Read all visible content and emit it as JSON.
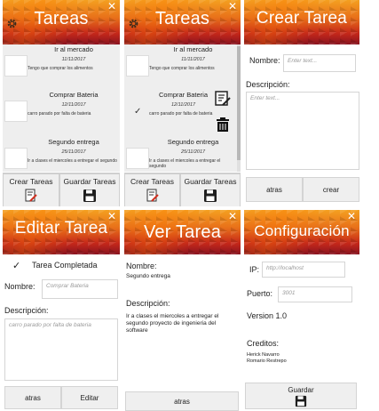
{
  "tareas_screen": {
    "title": "Tareas",
    "close": "✕",
    "tasks": [
      {
        "name": "Ir al mercado",
        "date": "11/11/2017",
        "desc": "Tengo que comprar los alimentos",
        "checked": false
      },
      {
        "name": "Comprar Bateria",
        "date": "12/11/2017",
        "desc": "carro parado por falta de bateria",
        "checked": false
      },
      {
        "name": "Segundo entrega",
        "date": "25/11/2017",
        "desc": "Ir a clases el miercoles a entregar el segundo",
        "checked": false
      }
    ],
    "create_label": "Crear Tareas",
    "save_label": "Guardar Tareas"
  },
  "tareas_screen_selected": {
    "title": "Tareas",
    "close": "✕",
    "check_mark": "✓",
    "tasks": [
      {
        "name": "Ir al mercado",
        "date": "11/11/2017",
        "desc": "Tengo que comprar los alimentos",
        "checked": false
      },
      {
        "name": "Comprar Bateria",
        "date": "12/11/2017",
        "desc": "carro parado por falta de bateria",
        "checked": true
      },
      {
        "name": "Segundo entrega",
        "date": "25/11/2017",
        "desc": "Ir a clases el miercoles a entregar el segundo",
        "checked": false
      }
    ],
    "create_label": "Crear Tareas",
    "save_label": "Guardar Tareas"
  },
  "crear_screen": {
    "title": "Crear Tarea",
    "nombre_label": "Nombre:",
    "nombre_placeholder": "Enter text...",
    "descripcion_label": "Descripción:",
    "descripcion_placeholder": "Enter text...",
    "back_label": "atras",
    "create_label": "crear"
  },
  "editar_screen": {
    "title": "Editar Tarea",
    "close": "✕",
    "check_mark": "✓",
    "completed_label": "Tarea Completada",
    "nombre_label": "Nombre:",
    "nombre_value": "Comprar Bateria",
    "descripcion_label": "Descripción:",
    "descripcion_value": "carro parado por falta de bateria",
    "back_label": "atras",
    "edit_label": "Editar"
  },
  "ver_screen": {
    "title": "Ver Tarea",
    "close": "✕",
    "nombre_label": "Nombre:",
    "nombre_value": "Segundo entrega",
    "descripcion_label": "Descripción:",
    "descripcion_value": "Ir a clases el miercoles a entregar el segundo proyecto de ingenieria del software",
    "back_label": "atras"
  },
  "config_screen": {
    "title": "Configuración",
    "close": "✕",
    "ip_label": "IP:",
    "ip_placeholder": "http://localhost",
    "port_label": "Puerto:",
    "port_placeholder": "3001",
    "version": "Version 1.0",
    "credits_label": "Creditos:",
    "credit_1": "Herick Navarro",
    "credit_2": "Romario Restrepo",
    "save_label": "Guardar"
  },
  "colors": {
    "header_top": "#f4a020",
    "header_bottom": "#8a1420",
    "list_bg": "#eeeeee"
  }
}
